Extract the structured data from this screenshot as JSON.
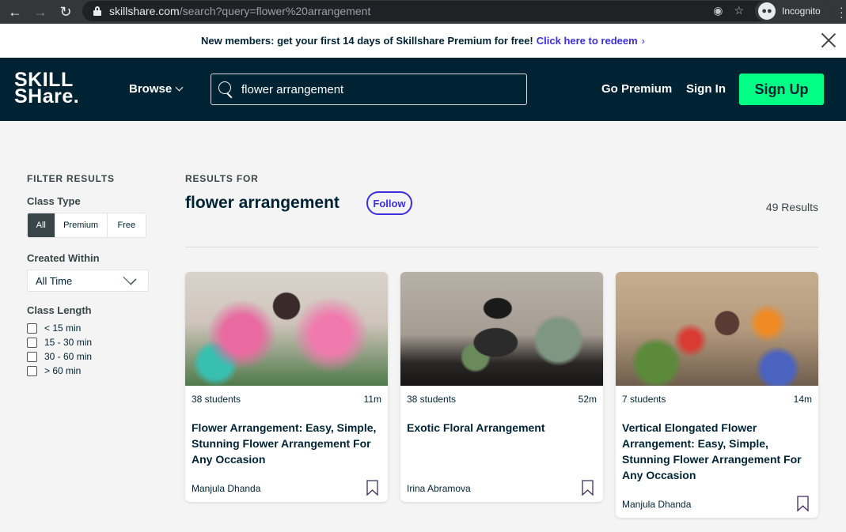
{
  "browser": {
    "url_host": "skillshare.com",
    "url_path": "/search?query=flower%20arrangement",
    "profile_label": "Incognito"
  },
  "promo": {
    "text": "New members: get your first 14 days of Skillshare Premium for free!",
    "link": "Click here to redeem"
  },
  "header": {
    "logo_line1": "SKILL",
    "logo_line2": "SHare.",
    "browse_label": "Browse",
    "search_value": "flower arrangement",
    "go_premium": "Go Premium",
    "sign_in": "Sign In",
    "sign_up": "Sign Up"
  },
  "filters": {
    "title": "FILTER RESULTS",
    "class_type_label": "Class Type",
    "class_types": [
      "All",
      "Premium",
      "Free"
    ],
    "class_type_selected": "All",
    "created_within_label": "Created Within",
    "created_within_value": "All Time",
    "class_length_label": "Class Length",
    "class_lengths": [
      "< 15 min",
      "15 - 30 min",
      "30 - 60 min",
      "> 60 min"
    ]
  },
  "results": {
    "heading": "RESULTS FOR",
    "query": "flower arrangement",
    "follow_label": "Follow",
    "count": "49 Results"
  },
  "cards": [
    {
      "students": "38 students",
      "duration": "11m",
      "title": "Flower Arrangement: Easy, Simple, Stunning Flower Arrangement For Any Occasion",
      "teacher": "Manjula Dhanda"
    },
    {
      "students": "38 students",
      "duration": "52m",
      "title": "Exotic Floral Arrangement",
      "teacher": "Irina Abramova"
    },
    {
      "students": "7 students",
      "duration": "14m",
      "title": "Vertical Elongated Flower Arrangement: Easy, Simple, Stunning Flower Arrangement For Any Occasion",
      "teacher": "Manjula Dhanda"
    }
  ],
  "colors": {
    "header_bg": "#002333",
    "accent_green": "#00ff84",
    "link_purple": "#3d2ee0",
    "page_bg": "#f4f4f4"
  }
}
